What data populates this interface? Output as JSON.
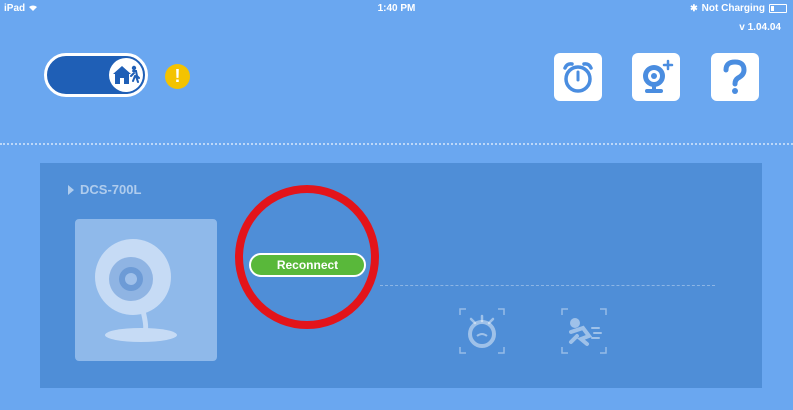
{
  "status_bar": {
    "device": "iPad",
    "time": "1:40 PM",
    "charging": "Not Charging"
  },
  "app": {
    "version": "v 1.04.04"
  },
  "alert_symbol": "!",
  "icons": {
    "wifi": "wifi-icon",
    "bluetooth": "bluetooth-icon",
    "battery": "battery-icon",
    "home_away": "home-away-icon",
    "alarm": "alarm-clock-icon",
    "add_camera": "add-camera-icon",
    "help": "question-mark-icon",
    "cry": "cry-detection-icon",
    "motion": "motion-detection-icon"
  },
  "camera": {
    "name": "DCS-700L",
    "reconnect_label": "Reconnect"
  },
  "colors": {
    "background": "#6aa7f0",
    "panel": "#4f8ed7",
    "toggle": "#1f5fb6",
    "alert": "#f4c300",
    "reconnect": "#59b83a",
    "highlight_circle": "#e3141a"
  }
}
